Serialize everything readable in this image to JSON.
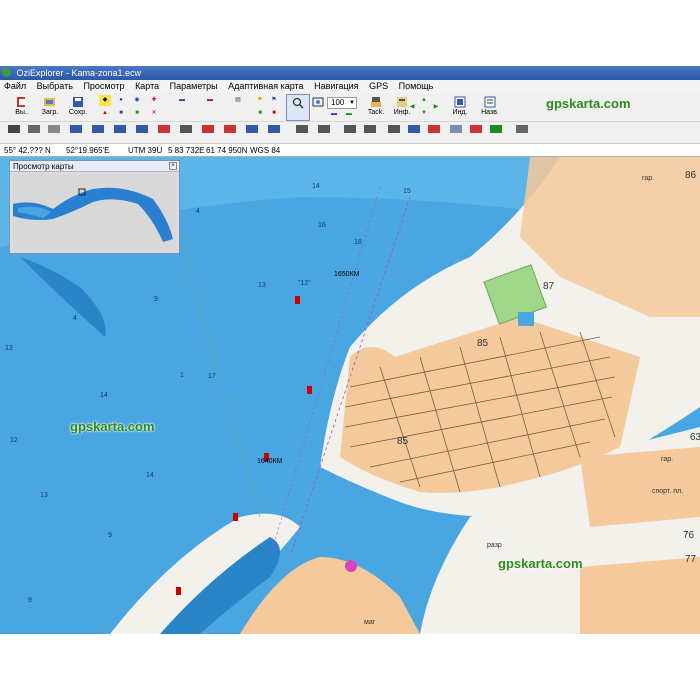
{
  "window": {
    "title": "OziExplorer - Kama-zona1.ecw"
  },
  "menu": [
    "Файл",
    "Выбрать",
    "Просмотр",
    "Карта",
    "Параметры",
    "Адаптивная карта",
    "Навигация",
    "GPS",
    "Помощь"
  ],
  "toolbar": {
    "buttons": [
      {
        "label": "Вы..",
        "icon": "exit-icon"
      },
      {
        "label": "Загр.",
        "icon": "load-map-icon"
      },
      {
        "label": "Сохр.",
        "icon": "save-icon"
      }
    ],
    "zoom_value": "100",
    "track_label": "Tack.",
    "info_label": "Инф.",
    "index_label": "Инд.",
    "name_label": "Назв.",
    "brand": "gpskarta.com"
  },
  "status": {
    "latitude": "55° 42.??? N",
    "longitude": "52°19.965'E",
    "utm_zone": "UTM 39U",
    "easting": "5 83 732E",
    "northing": "61 74 950N",
    "datum": "WGS 84"
  },
  "overview": {
    "title": "Просмотр карты"
  },
  "map": {
    "watermarks": [
      "gpskarta.com",
      "gpskarta.com"
    ],
    "depths": [
      "14",
      "15",
      "4",
      "16",
      "18",
      "9",
      "13",
      "4",
      "13",
      "14",
      "12",
      "13",
      "14",
      "9",
      "9",
      "1",
      "17"
    ],
    "buoy_label": "\"12\"",
    "km_label_1": "1650КМ",
    "km_label_2": "1640КМ",
    "block_numbers": [
      "87",
      "85",
      "85",
      "86",
      "76",
      "77",
      "63"
    ],
    "place_labels": [
      "гар.",
      "гар.",
      "спорт. пл.",
      "разр",
      "маг"
    ]
  }
}
